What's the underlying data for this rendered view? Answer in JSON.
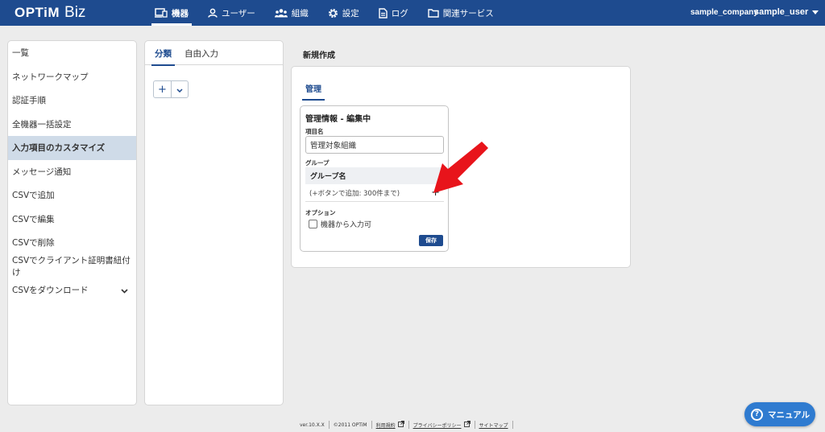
{
  "header": {
    "logo_main": "OPTiM",
    "logo_sub": "Biz",
    "nav": [
      {
        "label": "機器",
        "icon": "device-icon",
        "active": true
      },
      {
        "label": "ユーザー",
        "icon": "user-icon",
        "active": false
      },
      {
        "label": "組織",
        "icon": "group-icon",
        "active": false
      },
      {
        "label": "設定",
        "icon": "gear-icon",
        "active": false
      },
      {
        "label": "ログ",
        "icon": "document-icon",
        "active": false
      },
      {
        "label": "関連サービス",
        "icon": "folder-icon",
        "active": false
      }
    ],
    "company": "sample_company",
    "user": "sample_user"
  },
  "sidebar": {
    "items": [
      {
        "label": "一覧"
      },
      {
        "label": "ネットワークマップ"
      },
      {
        "label": "認証手順"
      },
      {
        "label": "全機器一括設定"
      },
      {
        "label": "入力項目のカスタマイズ",
        "active": true
      },
      {
        "label": "メッセージ通知"
      },
      {
        "label": "CSVで追加"
      },
      {
        "label": "CSVで編集"
      },
      {
        "label": "CSVで削除"
      },
      {
        "label": "CSVでクライアント証明書紐付け"
      },
      {
        "label": "CSVをダウンロード",
        "expandable": true
      }
    ]
  },
  "middle": {
    "tabs": [
      {
        "label": "分類",
        "active": true
      },
      {
        "label": "自由入力",
        "active": false
      }
    ],
    "add_label": "+"
  },
  "main": {
    "title": "新規作成",
    "tab": "管理",
    "card": {
      "title": "管理情報 - 編集中",
      "item_name_label": "項目名",
      "item_name_value": "管理対象組織",
      "group_label": "グループ",
      "group_header": "グループ名",
      "group_hint": "(+ボタンで追加: 300件まで)",
      "plus": "+",
      "option_label": "オプション",
      "checkbox_label": "機器から入力可",
      "checkbox_checked": false,
      "save": "保存"
    }
  },
  "footer": {
    "version": "ver.10.X.X",
    "copyright": "©2011 OPTiM",
    "terms": "利用規約",
    "privacy": "プライバシーポリシー",
    "sitemap": "サイトマップ"
  },
  "manual_button": "マニュアル",
  "colors": {
    "brand": "#1e4b8f",
    "sidebar_active": "#cfdbe8",
    "manual": "#2f7bd0",
    "arrow": "#e8141b"
  }
}
